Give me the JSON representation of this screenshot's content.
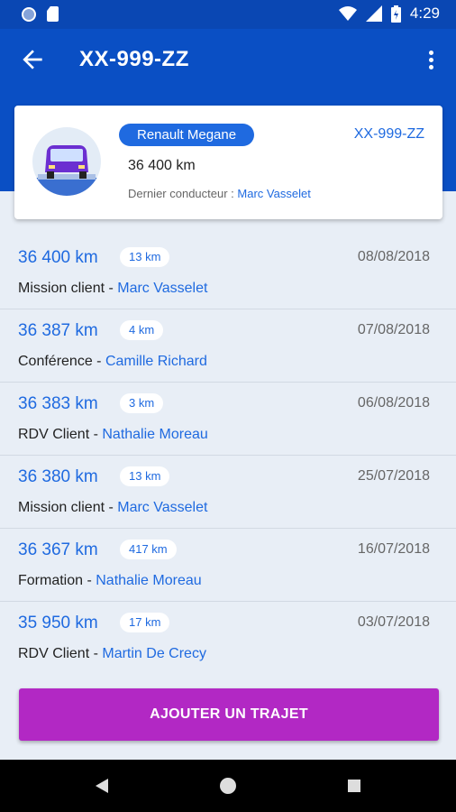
{
  "status_bar": {
    "time": "4:29"
  },
  "app_bar": {
    "title": "XX-999-ZZ"
  },
  "vehicle": {
    "model": "Renault Megane",
    "plate": "XX-999-ZZ",
    "mileage": "36 400 km",
    "last_driver_label": "Dernier conducteur :",
    "last_driver_name": "Marc Vasselet"
  },
  "trips": [
    {
      "km": "36 400 km",
      "distance": "13 km",
      "date": "08/08/2018",
      "purpose": "Mission client",
      "driver": "Marc Vasselet"
    },
    {
      "km": "36 387 km",
      "distance": "4 km",
      "date": "07/08/2018",
      "purpose": "Conférence",
      "driver": "Camille Richard"
    },
    {
      "km": "36 383 km",
      "distance": "3 km",
      "date": "06/08/2018",
      "purpose": "RDV Client",
      "driver": "Nathalie Moreau"
    },
    {
      "km": "36 380 km",
      "distance": "13 km",
      "date": "25/07/2018",
      "purpose": "Mission client",
      "driver": "Marc Vasselet"
    },
    {
      "km": "36 367 km",
      "distance": "417 km",
      "date": "16/07/2018",
      "purpose": "Formation",
      "driver": "Nathalie Moreau"
    },
    {
      "km": "35 950 km",
      "distance": "17 km",
      "date": "03/07/2018",
      "purpose": "RDV Client",
      "driver": "Martin De Crecy"
    }
  ],
  "add_button": {
    "label": "AJOUTER UN TRAJET"
  },
  "colors": {
    "primary": "#0a4fc4",
    "accent": "#b228c4",
    "link": "#1f6ae0"
  }
}
